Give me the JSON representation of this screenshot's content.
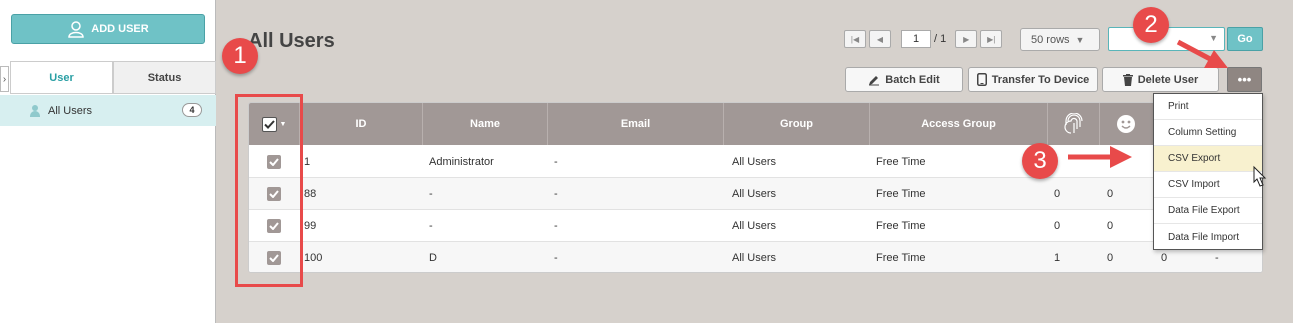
{
  "sidebar": {
    "add_user_label": "ADD USER",
    "tabs": [
      {
        "label": "User",
        "active": true
      },
      {
        "label": "Status",
        "active": false
      }
    ],
    "tree": {
      "label": "All Users",
      "count": "4"
    }
  },
  "header": {
    "title": "All Users"
  },
  "pager": {
    "current": "1",
    "total": "/ 1"
  },
  "rows_select": {
    "value": "50 rows"
  },
  "search": {
    "go_label": "Go"
  },
  "toolbar": {
    "batch_edit": "Batch Edit",
    "transfer": "Transfer To Device",
    "delete_user": "Delete User",
    "more": "•••"
  },
  "table": {
    "headers": {
      "id": "ID",
      "name": "Name",
      "email": "Email",
      "group": "Group",
      "access_group": "Access Group"
    },
    "rows": [
      {
        "id": "1",
        "name": "Administrator",
        "email": "-",
        "group": "All Users",
        "access": "Free Time",
        "fp": "",
        "face": "",
        "c3": "",
        "c4": ""
      },
      {
        "id": "88",
        "name": "-",
        "email": "-",
        "group": "All Users",
        "access": "Free Time",
        "fp": "0",
        "face": "0",
        "c3": "",
        "c4": ""
      },
      {
        "id": "99",
        "name": "-",
        "email": "-",
        "group": "All Users",
        "access": "Free Time",
        "fp": "0",
        "face": "0",
        "c3": "",
        "c4": ""
      },
      {
        "id": "100",
        "name": "D",
        "email": "-",
        "group": "All Users",
        "access": "Free Time",
        "fp": "1",
        "face": "0",
        "c3": "0",
        "c4": "-"
      }
    ]
  },
  "dropdown": {
    "items": [
      "Print",
      "Column Setting",
      "CSV Export",
      "CSV Import",
      "Data File Export",
      "Data File Import"
    ],
    "highlighted": "CSV Export"
  },
  "callouts": [
    "1",
    "2",
    "3"
  ],
  "colors": {
    "accent": "#6fc2c6",
    "header_bg": "#a19896",
    "callout": "#e84a4a",
    "canvas": "#d6d1cc"
  }
}
